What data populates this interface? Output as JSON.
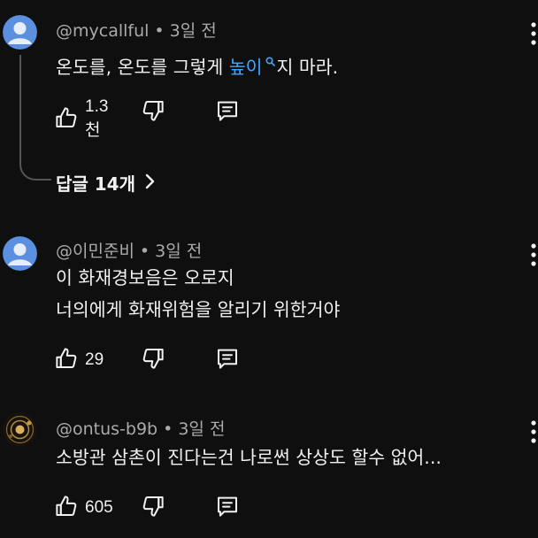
{
  "comments": [
    {
      "username": "@mycallful",
      "time": "3일 전",
      "text_before": "온도를, 온도를 그렇게 ",
      "text_highlight": "높이",
      "text_after": "지 마라.",
      "likes": "1.3천",
      "replies_label": "답글 14개"
    },
    {
      "username": "@이민준비",
      "time": "3일 전",
      "lines": [
        "이 화재경보음은 오로지",
        "너의에게 화재위험을 알리기 위한거야"
      ],
      "likes": "29"
    },
    {
      "username": "@ontus-b9b",
      "time": "3일 전",
      "text": "소방관 삼촌이 진다는건 나로썬 상상도 할수 없어...",
      "likes": "605"
    }
  ],
  "separator": "•",
  "icons": {
    "like": "thumbs-up-icon",
    "dislike": "thumbs-down-icon",
    "reply": "comment-icon",
    "more": "more-vertical-icon",
    "expand": "chevron-right-icon",
    "search": "search-icon"
  },
  "colors": {
    "background": "#0f0f0f",
    "text": "#f1f1f1",
    "meta": "#aaaaaa",
    "link": "#3ea6ff",
    "avatar_blue": "#5b8fe0"
  }
}
